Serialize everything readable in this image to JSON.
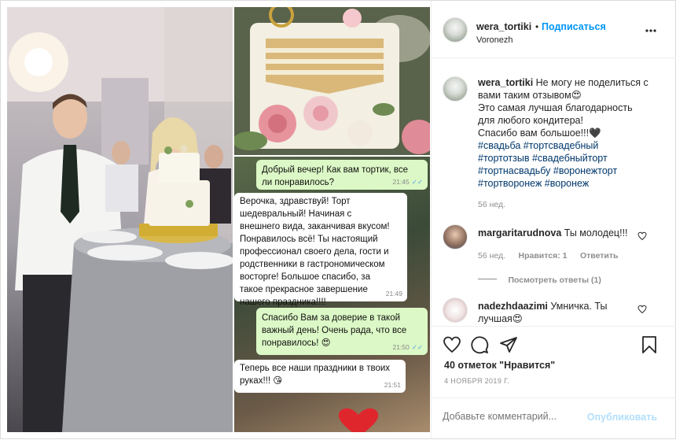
{
  "header": {
    "username": "wera_tortiki",
    "follow": "Подписаться",
    "location": "Voronezh",
    "more_icon": "more-horizontal-icon",
    "dot": "•"
  },
  "caption": {
    "username": "wera_tortiki",
    "lines": [
      "Не могу не поделиться с",
      "вами таким отзывом😍",
      "Это самая лучшая благодарность",
      "для любого кондитера!",
      "Спасибо вам большое!!!🖤"
    ],
    "tags": [
      "#свадьба #тортсвадебный",
      "#тортотзыв #свадебныйторт",
      "#тортнасвадьбу #воронежторт",
      "#тортворонеж #воронеж"
    ],
    "time": "56 нед."
  },
  "comments": [
    {
      "username": "margaritarudnova",
      "text": "Ты молодец!!!",
      "time": "56 нед.",
      "likes": "Нравится: 1",
      "reply": "Ответить",
      "view_replies": "Посмотреть ответы (1)"
    },
    {
      "username": "nadezhdaazimi",
      "text": "Умничка. Ты",
      "text2": "лучшая😍"
    }
  ],
  "actions": {
    "likes": "40 отметок \"Нравится\"",
    "date": "4 НОЯБРЯ 2019 Г.",
    "comment_placeholder": "Добавьте комментарий...",
    "publish": "Опубликовать"
  },
  "chat": [
    {
      "text": [
        "Добрый вечер! Как вам тортик, все",
        "ли понравилось?"
      ],
      "time": "21:45"
    },
    {
      "text": [
        "Верочка, здравствуй! Торт",
        "шедевральный! Начиная с",
        "внешнего вида, заканчивая вкусом!",
        "Понравилось всё! Ты настоящий",
        "профессионал своего дела, гости и",
        "родственники в гастрономическом",
        "восторге! Большое спасибо, за",
        "такое прекрасное завершение",
        "нашего праздника!!!!"
      ],
      "time": "21:49"
    },
    {
      "text": [
        "Спасибо Вам за доверие в такой",
        "важный день! Очень рада, что все",
        "понравилось! 😍"
      ],
      "time": "21:50"
    },
    {
      "text": [
        "Теперь все наши праздники в твоих",
        "руках!!! 😘"
      ],
      "time": "21:51"
    }
  ],
  "colors": {
    "link": "#0095f6",
    "hashtag": "#00376b",
    "whatsapp_out": "#dcf8c6",
    "muted": "#8e8e8e"
  }
}
